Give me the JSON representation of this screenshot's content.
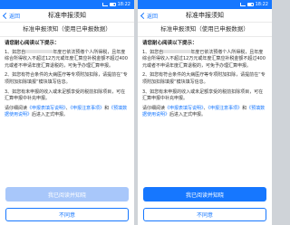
{
  "status_bar": {
    "time": "18:22"
  },
  "nav": {
    "back_label": "返回",
    "title": "标准申报须知"
  },
  "subtitle": "标准申报须知（使用已申报数据）",
  "content": {
    "lead": "请您耐心阅读以下提示：",
    "p1_before": "1、如您自",
    "p1_after": "年度已依法预缴个人所得税，且年度综合所得收入不超过12万元或年度汇算应补税金额不超过400元或者不申请年度汇算退税的，可免予办理汇算申报。",
    "p2": "2、如您有符合条件的大病医疗等专项附加扣除，请提前在“专项附加扣除填报”模块填写信息。",
    "p3": "3、如您有未申报的收入或未足额享受的税前扣除项目，可在汇算申报中补充申报。",
    "p4_before": "请仔细阅读",
    "link1": "《申报表填写说明》",
    "p4_sep1": "、",
    "link2": "《申报注意事项》",
    "p4_sep2": "和",
    "link3": "《预填数据使用说明》",
    "p4_after": "后进入正式申报。"
  },
  "left": {
    "confirm_label": "我已阅读并知晓",
    "disagree_label": "不同意"
  },
  "right": {
    "confirm_label": "我已阅读并知晓",
    "disagree_label": "不同意"
  },
  "colors": {
    "accent": "#1677ff",
    "disabled": "#a8c7fa"
  }
}
